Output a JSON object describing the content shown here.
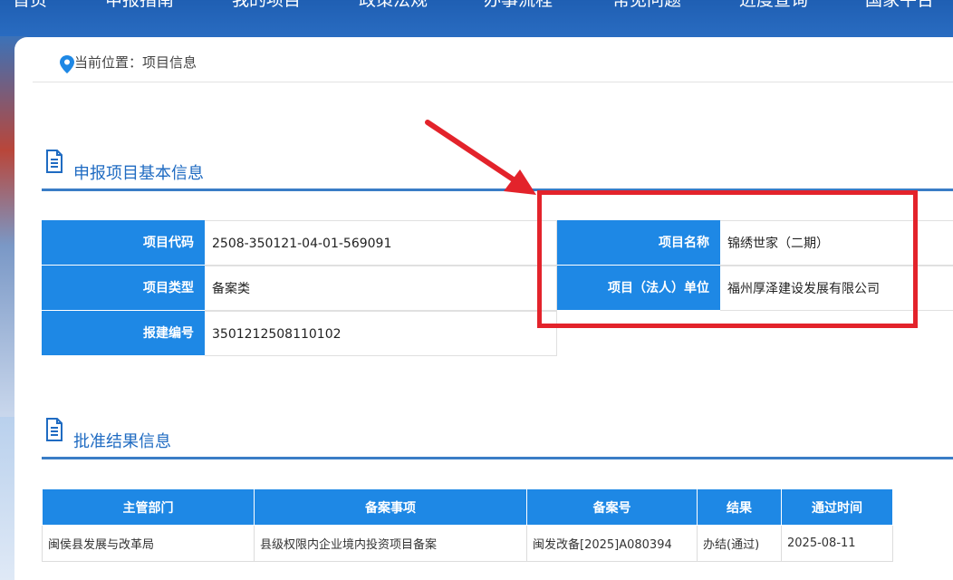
{
  "nav": {
    "items": [
      {
        "label": "首页"
      },
      {
        "label": "申报指南"
      },
      {
        "label": "我的项目"
      },
      {
        "label": "政策法规"
      },
      {
        "label": "办事流程"
      },
      {
        "label": "常见问题"
      },
      {
        "label": "进度查询"
      },
      {
        "label": "国家平台"
      }
    ]
  },
  "breadcrumb": {
    "label": "当前位置：",
    "current": "项目信息"
  },
  "basic_info": {
    "title": "申报项目基本信息",
    "fields": {
      "project_code_label": "项目代码",
      "project_code": "2508-350121-04-01-569091",
      "project_name_label": "项目名称",
      "project_name": "锦绣世家（二期）",
      "project_type_label": "项目类型",
      "project_type": "备案类",
      "legal_unit_label": "项目（法人）单位",
      "legal_unit": "福州厚泽建设发展有限公司",
      "build_no_label": "报建编号",
      "build_no": "3501212508110102"
    }
  },
  "approval": {
    "title": "批准结果信息",
    "headers": [
      "主管部门",
      "备案事项",
      "备案号",
      "结果",
      "通过时间"
    ],
    "rows": [
      [
        "闽侯县发展与改革局",
        "县级权限内企业境内投资项目备案",
        "闽发改备[2025]A080394",
        "办结(通过)",
        "2025-08-11"
      ]
    ]
  },
  "colors": {
    "accent": "#1e88e5",
    "title_blue": "#1f6bc2",
    "annotation_red": "#e3232b"
  }
}
